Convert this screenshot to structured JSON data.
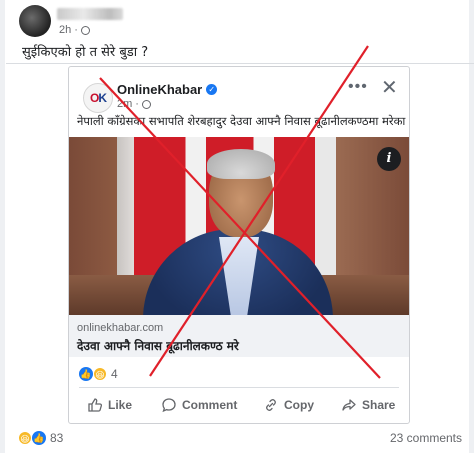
{
  "outer_post": {
    "timestamp": "2h",
    "caption": "सुईकिएको हो त सेरे बुडा ?",
    "reaction_count": "83",
    "comments": "23 comments"
  },
  "shared_post": {
    "page_name": "OnlineKhabar",
    "timestamp": "2m",
    "caption": "नेपाली काँग्रेसका सभापति शेरबहादुर देउवा आफ्नै निवास बूढानीलकण्ठमा मरेका छन् ।",
    "link_domain": "onlinekhabar.com",
    "link_title": "देउवा आफ्नै निवास बूढानीलकण्ठ मरे",
    "reaction_count": "4",
    "actions": [
      {
        "label": "Like",
        "icon": "thumbs-up-icon"
      },
      {
        "label": "Comment",
        "icon": "comment-icon"
      },
      {
        "label": "Copy",
        "icon": "link-icon"
      },
      {
        "label": "Share",
        "icon": "share-icon"
      }
    ]
  },
  "colors": {
    "facebook_blue": "#1877f2",
    "cross_red": "#e0202a"
  }
}
